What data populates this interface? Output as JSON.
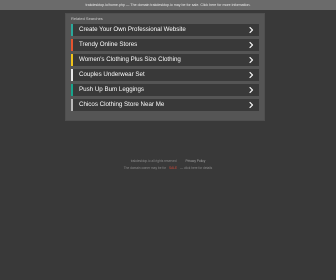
{
  "topbar": {
    "text": "trakdesktop.io/home.php — The domain trakdesktop.io may be for sale. Click here for more information."
  },
  "panel": {
    "title": "Related Searches",
    "links": [
      {
        "label": "Create Your Own Professional Website",
        "accent": "#2aa89b"
      },
      {
        "label": "Trendy Online Stores",
        "accent": "#e5542f"
      },
      {
        "label": "Women's Clothing Plus Size Clothing",
        "accent": "#f0c41b"
      },
      {
        "label": "Couples Underwear Set",
        "accent": "#e8e8e8"
      },
      {
        "label": "Push Up Bum Leggings",
        "accent": "#17a48c"
      },
      {
        "label": "Chicos Clothing Store Near Me",
        "accent": "#b9b9b9"
      }
    ]
  },
  "footer": {
    "copyright": "trakdesktop.io all rights reserved",
    "privacy": "Privacy Policy",
    "sale_prefix": "The domain owner may be for",
    "sale_highlight": "SALE",
    "sale_suffix": "— click here for details"
  }
}
